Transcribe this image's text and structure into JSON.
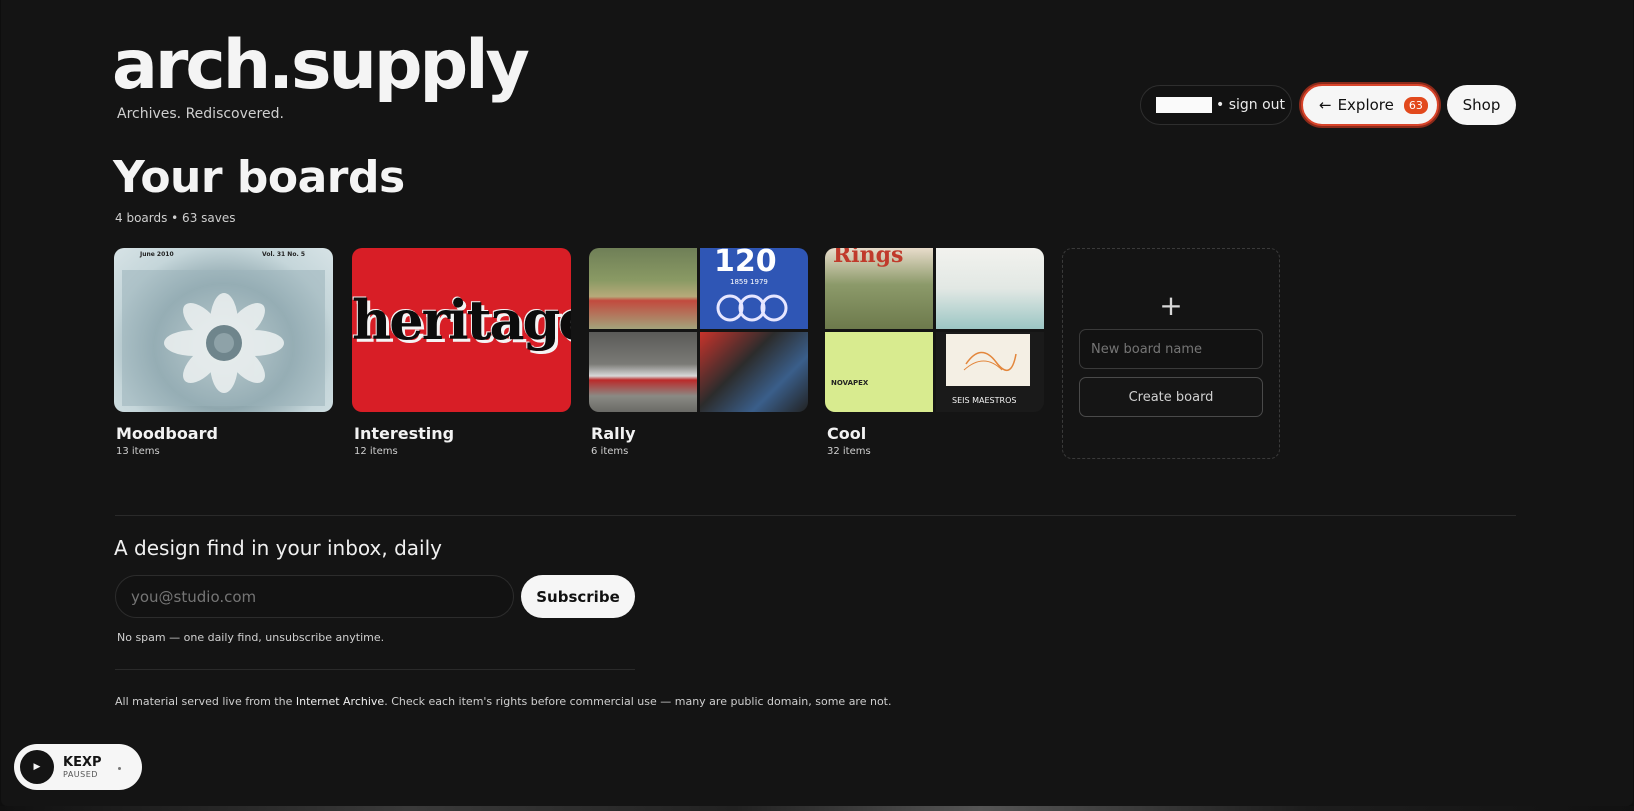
{
  "brand": {
    "logo": "arch.supply",
    "tagline": "Archives. Rediscovered."
  },
  "header": {
    "sign_out": "• sign out",
    "explore_label": "Explore",
    "explore_count": "63",
    "shop_label": "Shop"
  },
  "boards_section": {
    "title": "Your boards",
    "meta": "4 boards • 63 saves",
    "boards": [
      {
        "name": "Moodboard",
        "count": "13 items"
      },
      {
        "name": "Interesting",
        "count": "12 items"
      },
      {
        "name": "Rally",
        "count": "6 items"
      },
      {
        "name": "Cool",
        "count": "32 items"
      }
    ],
    "new_board": {
      "plus": "+",
      "placeholder": "New board name",
      "create_label": "Create board"
    },
    "thumb_text": {
      "moodboard_top_left": "June 2010",
      "moodboard_top_right": "Vol. 31 No. 5",
      "heritage": "heritage",
      "rally_120": "120",
      "rally_years": "1859 1979",
      "cool_rings": "Rings",
      "cool_brand": "NOVAPEX",
      "cool_maestros": "SEIS MAESTROS"
    }
  },
  "newsletter": {
    "title": "A design find in your inbox, daily",
    "placeholder": "you@studio.com",
    "subscribe_label": "Subscribe",
    "no_spam": "No spam — one daily find, unsubscribe anytime."
  },
  "footer": {
    "text_before": "All material served live from the ",
    "link": "Internet Archive",
    "text_after": ". Check each item's rights before commercial use — many are public domain, some are not."
  },
  "player": {
    "station": "KEXP",
    "status": "PAUSED"
  },
  "colors": {
    "background": "#141414",
    "accent": "#e2491d",
    "button": "#f6f6f6"
  }
}
